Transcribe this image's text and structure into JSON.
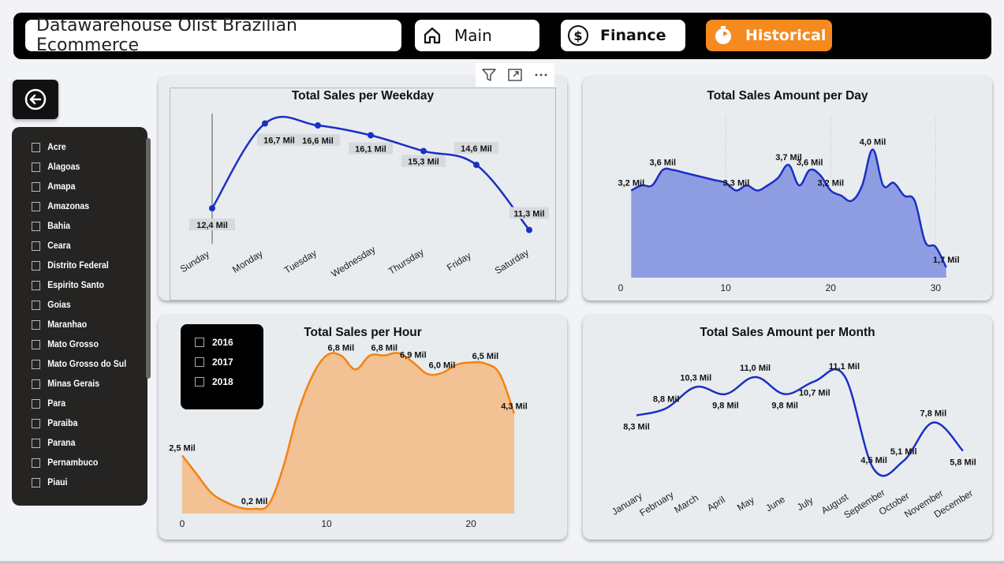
{
  "header": {
    "title": "Datawarehouse Olist Brazilian Ecommerce",
    "main_label": "Main",
    "finance_label": "Finance",
    "historical_label": "Historical",
    "accent": "#f58a1f"
  },
  "states": [
    "Acre",
    "Alagoas",
    "Amapa",
    "Amazonas",
    "Bahia",
    "Ceara",
    "Distrito Federal",
    "Espirito Santo",
    "Goias",
    "Maranhao",
    "Mato Grosso",
    "Mato Grosso do Sul",
    "Minas Gerais",
    "Para",
    "Paraiba",
    "Parana",
    "Pernambuco",
    "Piaui"
  ],
  "years": [
    "2016",
    "2017",
    "2018"
  ],
  "chart_data": [
    {
      "type": "line",
      "title": "Total Sales per Weekday",
      "categories": [
        "Sunday",
        "Monday",
        "Tuesday",
        "Wednesday",
        "Thursday",
        "Friday",
        "Saturday"
      ],
      "values": [
        12.4,
        16.7,
        16.6,
        16.1,
        15.3,
        14.6,
        11.3
      ],
      "labels": [
        "12,4 Mil",
        "16,7 Mil",
        "16,6 Mil",
        "16,1 Mil",
        "15,3 Mil",
        "14,6 Mil",
        "11,3 Mil"
      ],
      "ylim": [
        11,
        17
      ],
      "color": "#1b2fc4"
    },
    {
      "type": "area",
      "title": "Total Sales Amount per Day",
      "x": [
        1,
        2,
        3,
        4,
        5,
        6,
        7,
        8,
        9,
        10,
        11,
        12,
        13,
        14,
        15,
        16,
        17,
        18,
        19,
        20,
        21,
        22,
        23,
        24,
        25,
        26,
        27,
        28,
        29,
        30,
        31
      ],
      "values": [
        3.2,
        3.3,
        3.3,
        3.6,
        3.6,
        3.55,
        3.5,
        3.45,
        3.4,
        3.35,
        3.2,
        3.3,
        3.2,
        3.3,
        3.45,
        3.7,
        3.3,
        3.6,
        3.5,
        3.2,
        3.1,
        3.0,
        3.3,
        4.0,
        3.3,
        3.35,
        3.1,
        3.0,
        2.2,
        2.1,
        1.7
      ],
      "annotations": [
        {
          "x": 1,
          "label": "3,2 Mil"
        },
        {
          "x": 4,
          "label": "3,6 Mil"
        },
        {
          "x": 11,
          "label": "3,3 Mil"
        },
        {
          "x": 16,
          "label": "3,7 Mil"
        },
        {
          "x": 18,
          "label": "3,6 Mil"
        },
        {
          "x": 20,
          "label": "3,2 Mil"
        },
        {
          "x": 24,
          "label": "4,0 Mil"
        },
        {
          "x": 31,
          "label": "1,7 Mil"
        }
      ],
      "xticks": [
        0,
        10,
        20,
        30
      ],
      "xlim": [
        0,
        32
      ],
      "ylim": [
        1.5,
        4.5
      ],
      "color": "#1b2fc4",
      "fill": "#8e9de2"
    },
    {
      "type": "area",
      "title": "Total Sales per Hour",
      "x": [
        0,
        1,
        2,
        3,
        4,
        5,
        6,
        7,
        8,
        9,
        10,
        11,
        12,
        13,
        14,
        15,
        16,
        17,
        18,
        19,
        20,
        21,
        22,
        23
      ],
      "values": [
        2.5,
        1.7,
        0.9,
        0.5,
        0.25,
        0.2,
        0.4,
        2.0,
        4.3,
        5.9,
        6.8,
        6.8,
        6.2,
        6.8,
        6.8,
        6.9,
        6.5,
        6.0,
        6.05,
        6.4,
        6.5,
        6.45,
        6.0,
        4.3
      ],
      "annotations": [
        {
          "x": 0,
          "label": "2,5 Mil"
        },
        {
          "x": 5,
          "label": "0,2 Mil"
        },
        {
          "x": 11,
          "label": "6,8 Mil"
        },
        {
          "x": 14,
          "label": "6,8 Mil"
        },
        {
          "x": 16,
          "label": "6,9 Mil"
        },
        {
          "x": 18,
          "label": "6,0 Mil"
        },
        {
          "x": 21,
          "label": "6,5 Mil"
        },
        {
          "x": 23,
          "label": "4,3 Mil"
        }
      ],
      "xticks": [
        0,
        10,
        20
      ],
      "xlim": [
        0,
        23
      ],
      "ylim": [
        0,
        7.5
      ],
      "color": "#f5820f",
      "fill": "#f2c194"
    },
    {
      "type": "line",
      "title": "Total Sales Amount per Month",
      "categories": [
        "January",
        "February",
        "March",
        "April",
        "May",
        "June",
        "July",
        "August",
        "September",
        "October",
        "November",
        "December"
      ],
      "values": [
        8.3,
        8.8,
        10.3,
        9.8,
        11.0,
        9.8,
        10.7,
        11.1,
        4.5,
        5.1,
        7.8,
        5.8
      ],
      "labels": [
        "8,3 Mil",
        "8,8 Mil",
        "10,3 Mil",
        "9,8 Mil",
        "11,0 Mil",
        "9,8 Mil",
        "10,7 Mil",
        "11,1 Mil",
        "4,5 Mil",
        "5,1 Mil",
        "7,8 Mil",
        "5,8 Mil"
      ],
      "ylim": [
        4,
        12
      ],
      "color": "#1b2fc4"
    }
  ]
}
